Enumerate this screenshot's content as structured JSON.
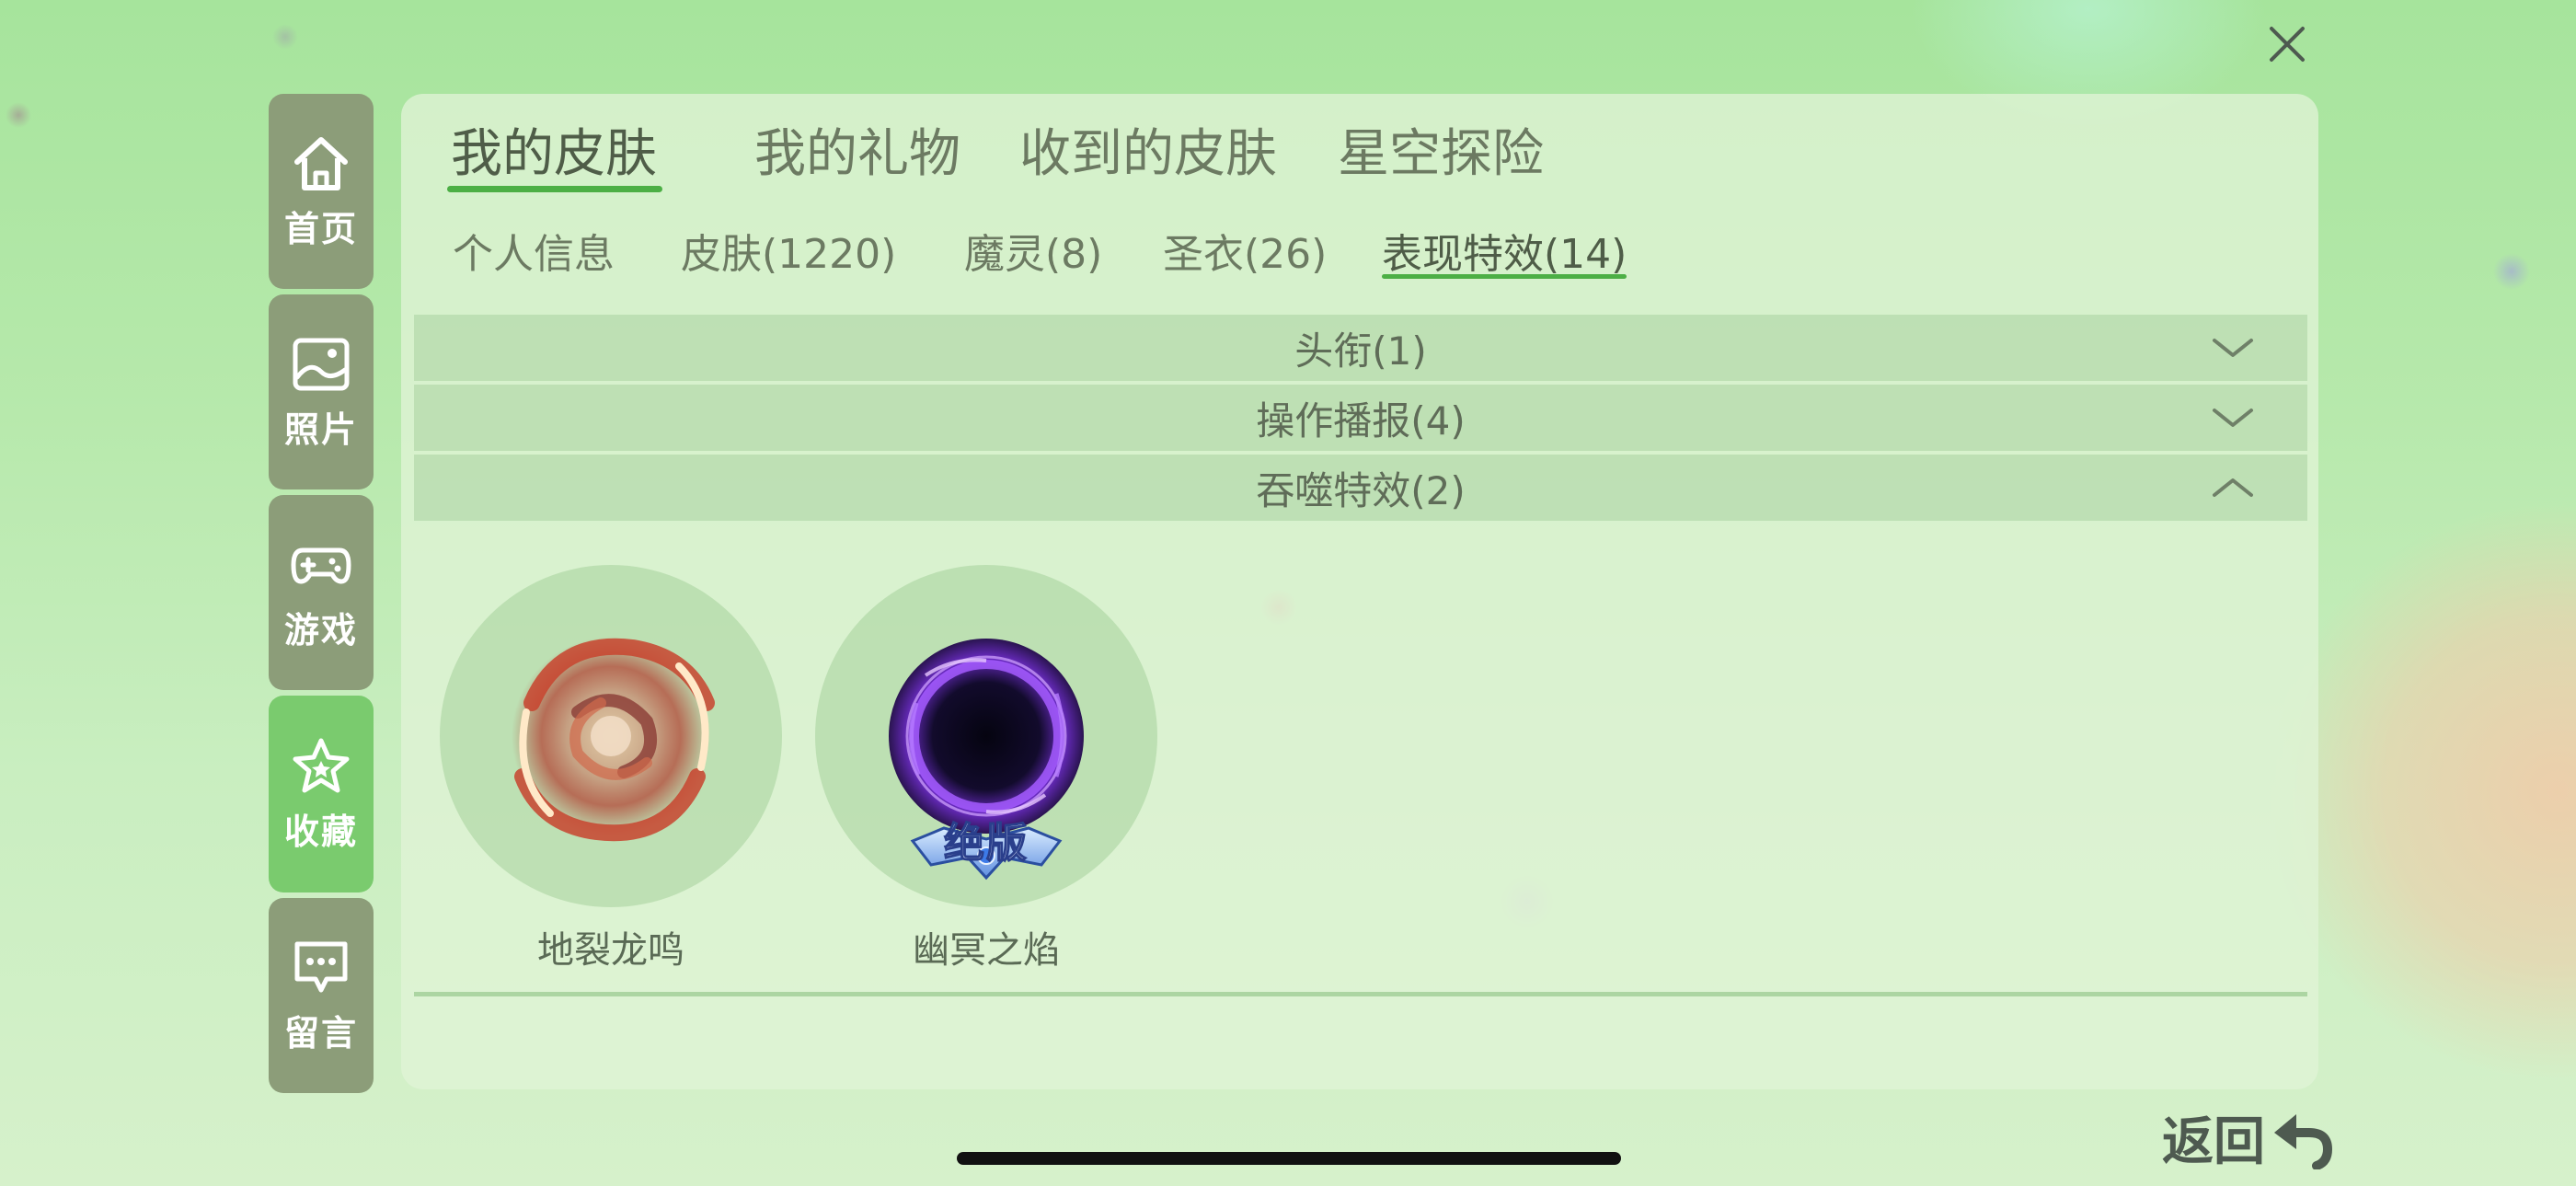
{
  "close": {
    "icon": "close-icon"
  },
  "sidebar": {
    "items": [
      {
        "label": "首页",
        "icon": "home-icon",
        "active": false
      },
      {
        "label": "照片",
        "icon": "image-icon",
        "active": false
      },
      {
        "label": "游戏",
        "icon": "gamepad-icon",
        "active": false
      },
      {
        "label": "收藏",
        "icon": "star-icon",
        "active": true
      },
      {
        "label": "留言",
        "icon": "message-icon",
        "active": false
      }
    ]
  },
  "main_tabs": [
    {
      "label": "我的皮肤",
      "active": true
    },
    {
      "label": "我的礼物",
      "active": false
    },
    {
      "label": "收到的皮肤",
      "active": false
    },
    {
      "label": "星空探险",
      "active": false
    }
  ],
  "sub_tabs": [
    {
      "label": "个人信息",
      "active": false
    },
    {
      "label": "皮肤(1220)",
      "active": false
    },
    {
      "label": "魔灵(8)",
      "active": false
    },
    {
      "label": "圣衣(26)",
      "active": false
    },
    {
      "label": "表现特效(14)",
      "active": true
    }
  ],
  "sections": [
    {
      "label": "头衔(1)",
      "expanded": false,
      "icon": "chevron-down-icon"
    },
    {
      "label": "操作播报(4)",
      "expanded": false,
      "icon": "chevron-down-icon"
    },
    {
      "label": "吞噬特效(2)",
      "expanded": true,
      "icon": "chevron-up-icon"
    }
  ],
  "effects": [
    {
      "name": "地裂龙鸣",
      "badge": ""
    },
    {
      "name": "幽冥之焰",
      "badge": "绝版"
    }
  ],
  "back": {
    "label": "返回",
    "icon": "return-arrow-icon"
  },
  "colors": {
    "accent": "#4caf45",
    "sidebar_bg": "#8c9d79",
    "sidebar_active": "#7acb6e",
    "text": "#5f6c58"
  }
}
